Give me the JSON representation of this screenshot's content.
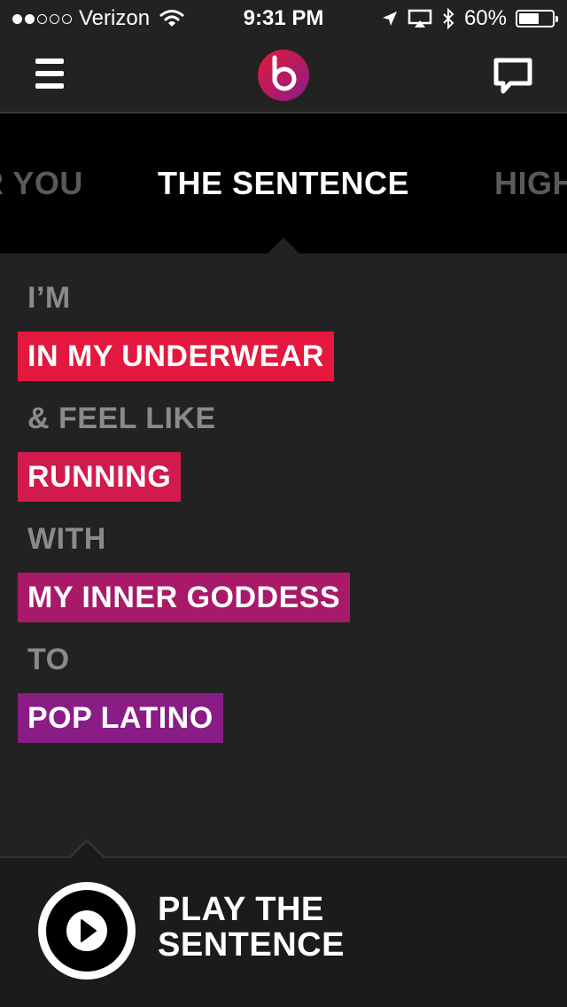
{
  "status_bar": {
    "carrier": "Verizon",
    "time": "9:31 PM",
    "battery": "60%",
    "battery_level": 0.6,
    "signal_bars_filled": 2,
    "signal_bars_total": 5
  },
  "nav": {
    "menu_icon": "hamburger-icon",
    "logo_icon": "beats-logo",
    "chat_icon": "chat-bubble-icon"
  },
  "tabs": [
    {
      "label": "R YOU",
      "state": "partial-left"
    },
    {
      "label": "THE SENTENCE",
      "state": "active"
    },
    {
      "label": "HIGH",
      "state": "partial-right"
    }
  ],
  "sentence": [
    {
      "type": "word",
      "text": "I’M"
    },
    {
      "type": "choice",
      "text": "IN MY UNDERWEAR",
      "color": "#e4173e"
    },
    {
      "type": "word",
      "text": "& FEEL LIKE"
    },
    {
      "type": "choice",
      "text": "RUNNING",
      "color": "#d21a4e"
    },
    {
      "type": "word",
      "text": "WITH"
    },
    {
      "type": "choice",
      "text": "MY INNER GODDESS",
      "color": "#a8196a"
    },
    {
      "type": "word",
      "text": "TO"
    },
    {
      "type": "choice",
      "text": "POP LATINO",
      "color": "#8a1c86"
    }
  ],
  "play": {
    "line1": "PLAY THE",
    "line2": "SENTENCE",
    "icon": "play-icon"
  },
  "colors": {
    "background": "#222222",
    "tab_bar": "#000000",
    "inactive_word": "#8a8a8a"
  }
}
